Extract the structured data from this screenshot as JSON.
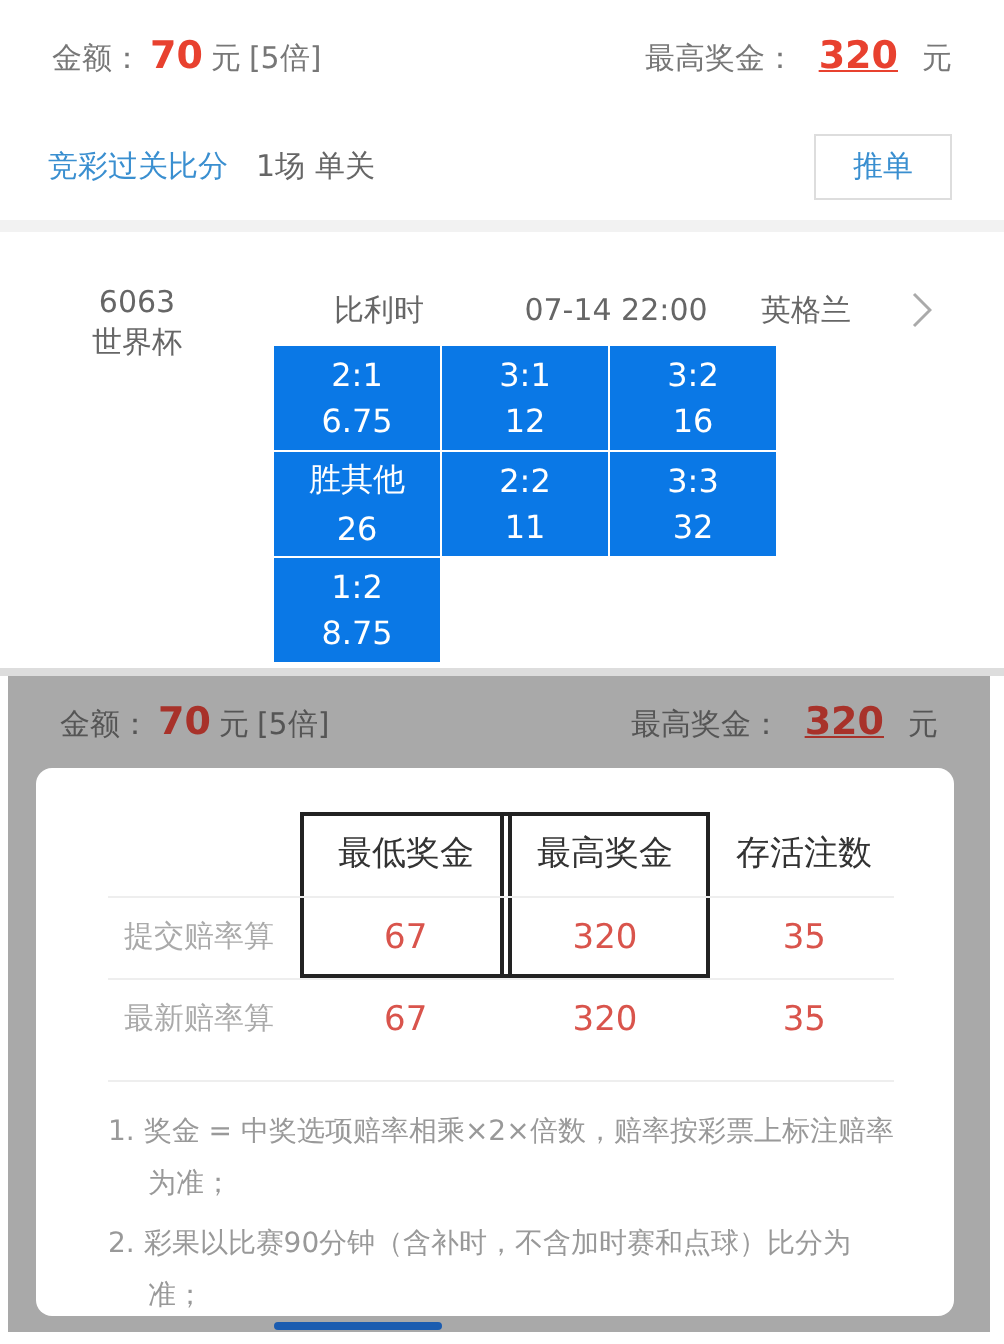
{
  "summary": {
    "amount_label": "金额：",
    "amount": "70",
    "amount_unit": "元",
    "multiplier": "[5倍]",
    "max_prize_label": "最高奖金：",
    "max_prize": "320",
    "max_prize_unit": "元"
  },
  "play": {
    "type_link": "竞彩过关比分",
    "info": "1场 单关",
    "button": "推单"
  },
  "match": {
    "number": "6063",
    "league": "世界杯",
    "home": "比利时",
    "time": "07-14 22:00",
    "away": "英格兰",
    "options": [
      {
        "score": "2:1",
        "odds": "6.75",
        "selected": true
      },
      {
        "score": "3:1",
        "odds": "12",
        "selected": true
      },
      {
        "score": "3:2",
        "odds": "16",
        "selected": true
      },
      {
        "score": "胜其他",
        "odds": "26",
        "selected": true
      },
      {
        "score": "2:2",
        "odds": "11",
        "selected": true
      },
      {
        "score": "3:3",
        "odds": "32",
        "selected": true
      },
      {
        "score": "1:2",
        "odds": "8.75",
        "selected": true
      }
    ]
  },
  "overlay": {
    "summary": {
      "amount_label": "金额：",
      "amount": "70",
      "amount_unit": "元",
      "multiplier": "[5倍]",
      "max_prize_label": "最高奖金：",
      "max_prize": "320",
      "max_prize_unit": "元"
    },
    "table": {
      "columns": [
        {
          "label": "最低奖金",
          "outlined": true
        },
        {
          "label": "最高奖金",
          "outlined": true
        },
        {
          "label": "存活注数",
          "outlined": false
        }
      ],
      "rows": [
        {
          "label": "提交赔率算",
          "values": [
            "67",
            "320",
            "35"
          ]
        },
        {
          "label": "最新赔率算",
          "values": [
            "67",
            "320",
            "35"
          ]
        }
      ]
    },
    "notes": [
      "1. 奖金 = 中奖选项赔率相乘×2×倍数，赔率按彩票上标注赔率为准；",
      "2. 彩果以比赛90分钟（含补时，不含加时赛和点球）比分为准；"
    ]
  }
}
